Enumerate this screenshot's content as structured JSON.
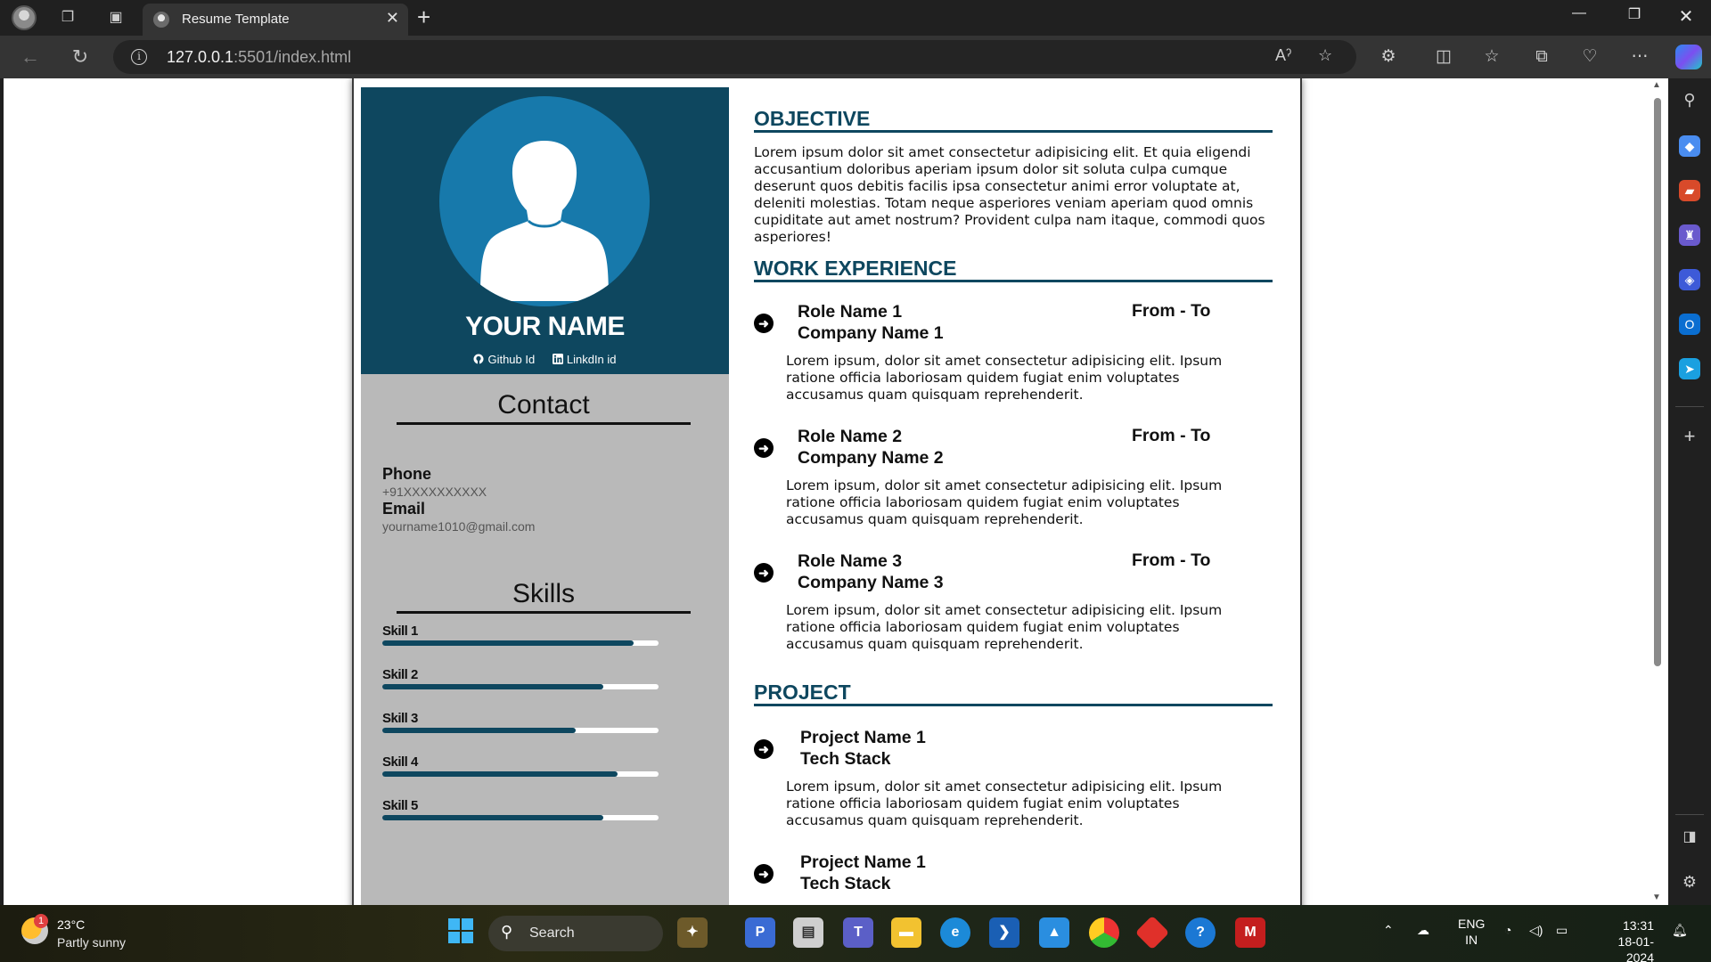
{
  "browser": {
    "tab_title": "Resume Template",
    "url_host": "127.0.0.1",
    "url_path": ":5501/index.html"
  },
  "resume": {
    "name": "YOUR NAME",
    "github": "Github Id",
    "linkedin": "LinkdIn id",
    "contact_heading": "Contact",
    "phone_label": "Phone",
    "phone_value": "+91XXXXXXXXXX",
    "email_label": "Email",
    "email_value": "yourname1010@gmail.com",
    "skills_heading": "Skills",
    "skills": [
      {
        "name": "Skill 1",
        "level": 0.91
      },
      {
        "name": "Skill 2",
        "level": 0.8
      },
      {
        "name": "Skill 3",
        "level": 0.7
      },
      {
        "name": "Skill 4",
        "level": 0.85
      },
      {
        "name": "Skill 5",
        "level": 0.8
      }
    ],
    "objective_heading": "OBJECTIVE",
    "objective_text": "Lorem ipsum dolor sit amet consectetur adipisicing elit. Et quia eligendi accusantium doloribus aperiam ipsum dolor sit soluta culpa cumque deserunt quos debitis facilis ipsa consectetur animi error voluptate at, deleniti molestias. Totam neque asperiores veniam aperiam quod omnis cupiditate aut amet nostrum? Provident culpa nam itaque, commodi quos asperiores!",
    "work_heading": "WORK EXPERIENCE",
    "work": [
      {
        "role": "Role Name 1",
        "company": "Company Name 1",
        "dates": "From - To",
        "desc": "Lorem ipsum, dolor sit amet consectetur adipisicing elit. Ipsum ratione officia laboriosam quidem fugiat enim voluptates accusamus quam quisquam reprehenderit."
      },
      {
        "role": "Role Name 2",
        "company": "Company Name 2",
        "dates": "From - To",
        "desc": "Lorem ipsum, dolor sit amet consectetur adipisicing elit. Ipsum ratione officia laboriosam quidem fugiat enim voluptates accusamus quam quisquam reprehenderit."
      },
      {
        "role": "Role Name 3",
        "company": "Company Name 3",
        "dates": "From - To",
        "desc": "Lorem ipsum, dolor sit amet consectetur adipisicing elit. Ipsum ratione officia laboriosam quidem fugiat enim voluptates accusamus quam quisquam reprehenderit."
      }
    ],
    "project_heading": "PROJECT",
    "projects": [
      {
        "name": "Project Name 1",
        "stack": "Tech Stack",
        "desc": "Lorem ipsum, dolor sit amet consectetur adipisicing elit. Ipsum ratione officia laboriosam quidem fugiat enim voluptates accusamus quam quisquam reprehenderit."
      },
      {
        "name": "Project Name 1",
        "stack": "Tech Stack"
      }
    ]
  },
  "taskbar": {
    "weather_temp": "23°C",
    "weather_desc": "Partly sunny",
    "weather_badge": "1",
    "search_label": "Search",
    "lang_1": "ENG",
    "lang_2": "IN",
    "time": "13:31",
    "date": "18-01-2024"
  },
  "colors": {
    "accent": "#0e475f",
    "avatar": "#1779ab",
    "sidebar_gray": "#b9b9b9"
  },
  "icons": [
    "profile-icon",
    "workspaces-icon",
    "tab-actions-icon",
    "back-icon",
    "refresh-icon",
    "info-icon",
    "read-aloud-icon",
    "favorite-star-icon",
    "extensions-icon",
    "split-screen-icon",
    "favorites-icon",
    "collections-icon",
    "health-icon",
    "more-icon",
    "copilot-icon",
    "github-icon",
    "linkedin-icon",
    "arrow-bullet-icon",
    "windows-start-icon",
    "search-icon",
    "wifi-icon",
    "volume-icon",
    "battery-icon",
    "notification-bell-icon"
  ]
}
